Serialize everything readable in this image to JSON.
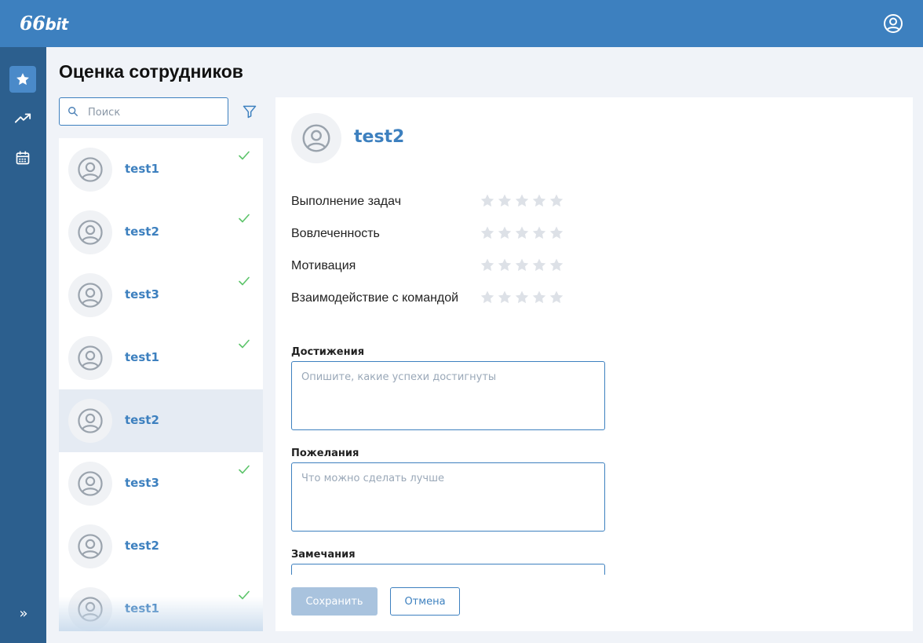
{
  "app": {
    "logo_main": "66",
    "logo_sub": "bit",
    "brand_color": "#3d80bf",
    "sidebar_color": "#2c5f8e"
  },
  "header": {
    "profile_icon": "user-circle-icon"
  },
  "sidebar": {
    "items": [
      {
        "icon": "star-icon",
        "active": true
      },
      {
        "icon": "trending-up-icon",
        "active": false
      },
      {
        "icon": "calendar-icon",
        "active": false
      }
    ],
    "expand_label": "»"
  },
  "page": {
    "title": "Оценка сотрудников"
  },
  "search": {
    "placeholder": "Поиск",
    "value": ""
  },
  "employees": [
    {
      "name": "test1",
      "rated": true,
      "selected": false
    },
    {
      "name": "test2",
      "rated": true,
      "selected": false
    },
    {
      "name": "test3",
      "rated": true,
      "selected": false
    },
    {
      "name": "test1",
      "rated": true,
      "selected": false
    },
    {
      "name": "test2",
      "rated": false,
      "selected": true
    },
    {
      "name": "test3",
      "rated": true,
      "selected": false
    },
    {
      "name": "test2",
      "rated": false,
      "selected": false
    },
    {
      "name": "test1",
      "rated": true,
      "selected": false
    }
  ],
  "detail": {
    "name": "test2",
    "criteria": [
      {
        "label": "Выполнение задач",
        "rating": 0,
        "max": 5
      },
      {
        "label": "Вовлеченность",
        "rating": 0,
        "max": 5
      },
      {
        "label": "Мотивация",
        "rating": 0,
        "max": 5
      },
      {
        "label": "Взаимодействие с командой",
        "rating": 0,
        "max": 5
      }
    ],
    "fields": [
      {
        "label": "Достижения",
        "placeholder": "Опишите, какие успехи достигнуты",
        "value": ""
      },
      {
        "label": "Пожелания",
        "placeholder": "Что можно сделать лучше",
        "value": ""
      },
      {
        "label": "Замечания",
        "placeholder": "",
        "value": ""
      }
    ],
    "save_label": "Сохранить",
    "cancel_label": "Отмена"
  },
  "colors": {
    "check": "#5cc46a",
    "star_empty": "#dde1e7"
  }
}
